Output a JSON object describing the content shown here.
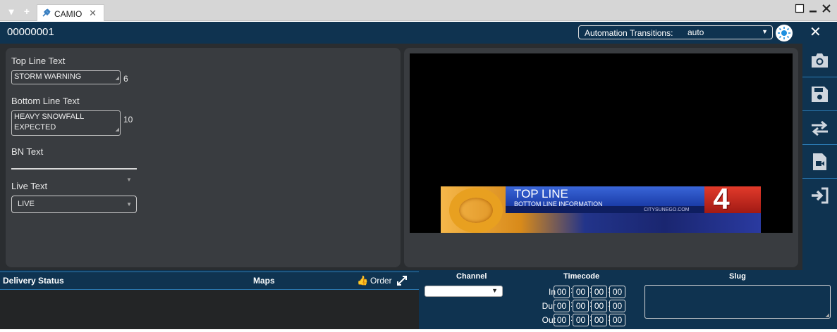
{
  "tab": {
    "label": "CAMIO",
    "close": "✕"
  },
  "header": {
    "item_id": "00000001",
    "automation_label": "Automation Transitions:",
    "automation_value": "auto",
    "close": "✕"
  },
  "form": {
    "top_line_label": "Top Line Text",
    "top_line_value": "STORM WARNING",
    "top_line_count": "6",
    "bottom_line_label": "Bottom Line Text",
    "bottom_line_value_1": "HEAVY SNOWFALL",
    "bottom_line_value_2": "EXPECTED",
    "bottom_line_count": "10",
    "bn_label": "BN Text",
    "live_label": "Live Text",
    "live_value": "LIVE"
  },
  "preview": {
    "top_line": "TOP LINE",
    "bottom_line": "BOTTOM LINE INFORMATION",
    "url": "CITYSUNEGO.COM",
    "channel_number": "4"
  },
  "toolbar": [
    "camera-icon",
    "save-icon",
    "swap-icon",
    "file-video-icon",
    "sign-in-icon"
  ],
  "bottom": {
    "delivery_status": "Delivery Status",
    "maps": "Maps",
    "order": "Order",
    "channel": "Channel",
    "timecode": "Timecode",
    "slug": "Slug",
    "in_label": "In",
    "dur_label": "Dur",
    "out_label": "Out",
    "tc_in": [
      "00",
      "00",
      "00",
      "00"
    ],
    "tc_dur": [
      "00",
      "00",
      "00",
      "00"
    ],
    "tc_out": [
      "00",
      "00",
      "00",
      "00"
    ]
  }
}
